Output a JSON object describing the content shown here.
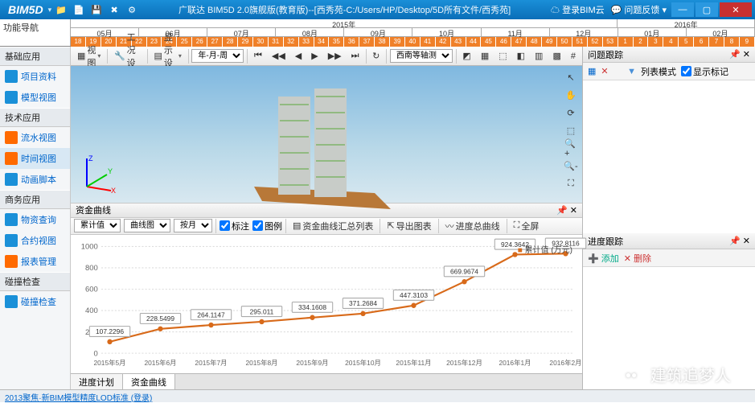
{
  "app": {
    "brand": "BIM5D",
    "title": "广联达 BIM5D 2.0旗舰版(教育版)--[西秀苑-C:/Users/HP/Desktop/5D所有文件/西秀苑]"
  },
  "titlebar_links": {
    "login": "登录BIM云",
    "feedback": "问题反馈"
  },
  "nav_label": "功能导航",
  "timeline": {
    "years": [
      {
        "label": "2015年",
        "span": 8
      },
      {
        "label": "2016年",
        "span": 2
      }
    ],
    "months": [
      "05月",
      "06月",
      "07月",
      "08月",
      "09月",
      "10月",
      "11月",
      "12月",
      "01月",
      "02月"
    ],
    "ticks": [
      "18",
      "19",
      "20",
      "21",
      "22",
      "23",
      "24",
      "25",
      "26",
      "27",
      "28",
      "29",
      "30",
      "31",
      "32",
      "33",
      "34",
      "35",
      "36",
      "37",
      "38",
      "39",
      "40",
      "41",
      "42",
      "43",
      "44",
      "45",
      "46",
      "47",
      "48",
      "49",
      "50",
      "51",
      "52",
      "53",
      "1",
      "2",
      "3",
      "4",
      "5",
      "6",
      "7",
      "8",
      "9"
    ]
  },
  "sidebar": {
    "groups": [
      {
        "label": "基础应用",
        "items": [
          {
            "label": "项目资料",
            "color": "#1a90d8"
          },
          {
            "label": "模型视图",
            "color": "#1a90d8"
          }
        ]
      },
      {
        "label": "技术应用",
        "items": [
          {
            "label": "流水视图",
            "color": "#ff6a00"
          },
          {
            "label": "时间视图",
            "color": "#ff6a00",
            "active": true
          },
          {
            "label": "动画脚本",
            "color": "#1a90d8"
          }
        ]
      },
      {
        "label": "商务应用",
        "items": [
          {
            "label": "物资查询",
            "color": "#1a90d8"
          },
          {
            "label": "合约视图",
            "color": "#1a90d8"
          },
          {
            "label": "报表管理",
            "color": "#ff6a00"
          }
        ]
      },
      {
        "label": "碰撞检查",
        "items": [
          {
            "label": "碰撞检查",
            "color": "#1a90d8"
          }
        ]
      }
    ]
  },
  "toolbar": {
    "view": "视图",
    "work": "工况设置",
    "display": "显示设置",
    "period": "年-月-周",
    "orient": "西南等轴测"
  },
  "panel_curve": "资金曲线",
  "chart_toolbar": {
    "metric": "累计值",
    "chart_type": "曲线图",
    "by": "按月",
    "label": "标注",
    "line": "图例",
    "summary": "资金曲线汇总列表",
    "export": "导出图表",
    "progress": "进度总曲线",
    "fullscreen": "全屏"
  },
  "chart_data": {
    "type": "line",
    "xlabel": "",
    "ylabel": "",
    "legend": "累计值 (万元)",
    "x": [
      "2015年5月",
      "2015年6月",
      "2015年7月",
      "2015年8月",
      "2015年9月",
      "2015年10月",
      "2015年11月",
      "2015年12月",
      "2016年1月",
      "2016年2月"
    ],
    "values": [
      107.2296,
      228.5499,
      264.1147,
      295.011,
      334.1608,
      371.2684,
      447.3103,
      669.9674,
      924.3642,
      932.8116
    ],
    "ylim": [
      0,
      1000
    ],
    "yticks": [
      0,
      200,
      400,
      600,
      800,
      1000
    ]
  },
  "tabs": {
    "t1": "进度计划",
    "t2": "资金曲线"
  },
  "right": {
    "issue": "问题跟踪",
    "mode": "列表模式",
    "mark": "显示标记",
    "progress": "进度跟踪",
    "add": "添加",
    "del": "删除"
  },
  "statusbar": "2013聚焦·新BIM模型精度LOD标准 (登录)",
  "watermark": "建筑追梦人"
}
